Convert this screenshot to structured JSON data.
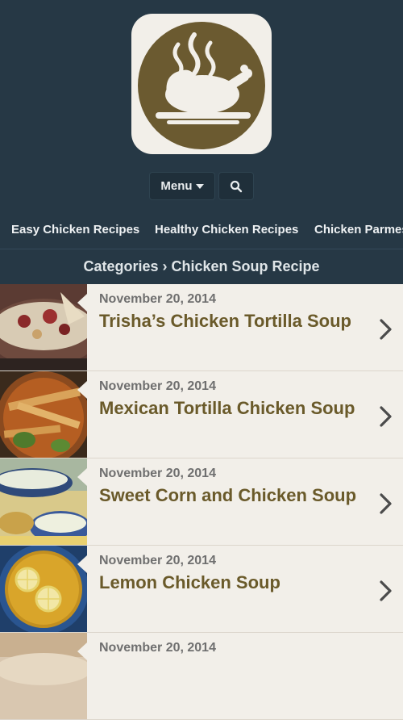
{
  "header": {
    "logo_icon": "roast-chicken-icon",
    "menu_label": "Menu",
    "search_icon": "search-icon"
  },
  "nav": {
    "items": [
      "Easy Chicken Recipes",
      "Healthy Chicken Recipes",
      "Chicken Parmes"
    ]
  },
  "breadcrumb": {
    "text": "Categories › Chicken Soup Recipe"
  },
  "posts": [
    {
      "date": "November 20, 2014",
      "title": "Trisha’s Chicken Tortilla Soup"
    },
    {
      "date": "November 20, 2014",
      "title": "Mexican Tortilla Chicken Soup"
    },
    {
      "date": "November 20, 2014",
      "title": "Sweet Corn and Chicken Soup"
    },
    {
      "date": "November 20, 2014",
      "title": "Lemon Chicken Soup"
    },
    {
      "date": "November 20, 2014",
      "title": ""
    }
  ],
  "colors": {
    "header_bg": "#263845",
    "list_bg": "#f2efe9",
    "title_color": "#6a5a2a",
    "logo_brown": "#6b5a30"
  }
}
